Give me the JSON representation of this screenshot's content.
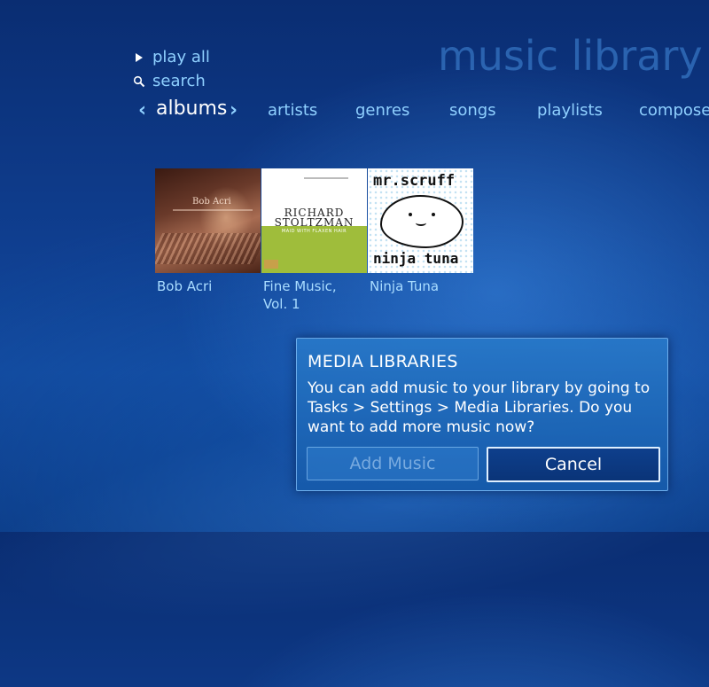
{
  "header": {
    "title": "music library"
  },
  "menu": {
    "items": [
      {
        "label": "play all",
        "icon": "play-icon"
      },
      {
        "label": "search",
        "icon": "search-icon"
      }
    ]
  },
  "tabs": {
    "active": "albums",
    "items": [
      "artists",
      "genres",
      "songs",
      "playlists",
      "composers"
    ]
  },
  "albums": [
    {
      "title": "Bob Acri",
      "cover_text": "Bob Acri"
    },
    {
      "title": "Fine Music, Vol. 1",
      "cover_line1": "RICHARD",
      "cover_line2": "STOLTZMAN",
      "cover_sub": "MAID WITH FLAXEN HAIR"
    },
    {
      "title": "Ninja Tuna",
      "cover_top": "mr.scruff",
      "cover_bottom": "ninja tuna"
    }
  ],
  "dialog": {
    "title": "MEDIA LIBRARIES",
    "message": "You can add music to your library by going to Tasks > Settings > Media Libraries. Do you want to add more music now?",
    "buttons": {
      "add": "Add Music",
      "cancel": "Cancel"
    }
  },
  "colors": {
    "accent": "#8fd0ff",
    "background": "#0f3e8f",
    "dialog": "#1e6fbf"
  }
}
